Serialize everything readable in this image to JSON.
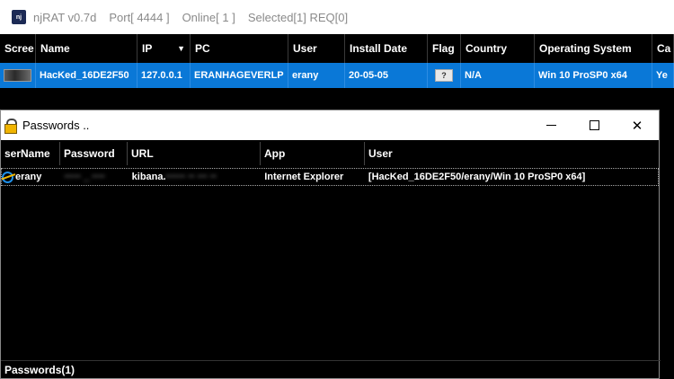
{
  "main_window": {
    "icon_label": "nj",
    "title_segments": [
      "njRAT v0.7d",
      "Port[ 4444 ]",
      "Online[ 1 ]",
      "Selected[1] REQ[0]"
    ]
  },
  "main_table": {
    "headers": [
      "Scree",
      "Name",
      "IP",
      "PC",
      "User",
      "Install Date",
      "Flag",
      "Country",
      "Operating System",
      "Ca"
    ],
    "row": {
      "name": "HacKed_16DE2F50",
      "ip": "127.0.0.1",
      "pc": "ERANHAGEVERLP",
      "user": "erany",
      "install_date": "20-05-05",
      "flag": "?",
      "country": "N/A",
      "os": "Win 10 ProSP0 x64",
      "ca": "Ye"
    },
    "selected_color": "#0a78d7"
  },
  "passwords_window": {
    "title": "Passwords ..",
    "headers": [
      "serName",
      "Password",
      "URL",
      "App",
      "User"
    ],
    "row": {
      "username": "erany",
      "password": "····· _ ····",
      "url_visible": "kibana.",
      "url_hidden": "······ ·· ··· ··",
      "app": "Internet Explorer",
      "user": "[HacKed_16DE2F50/erany/Win 10 ProSP0 x64]"
    },
    "status": "Passwords(1)",
    "close_glyph": "✕"
  }
}
